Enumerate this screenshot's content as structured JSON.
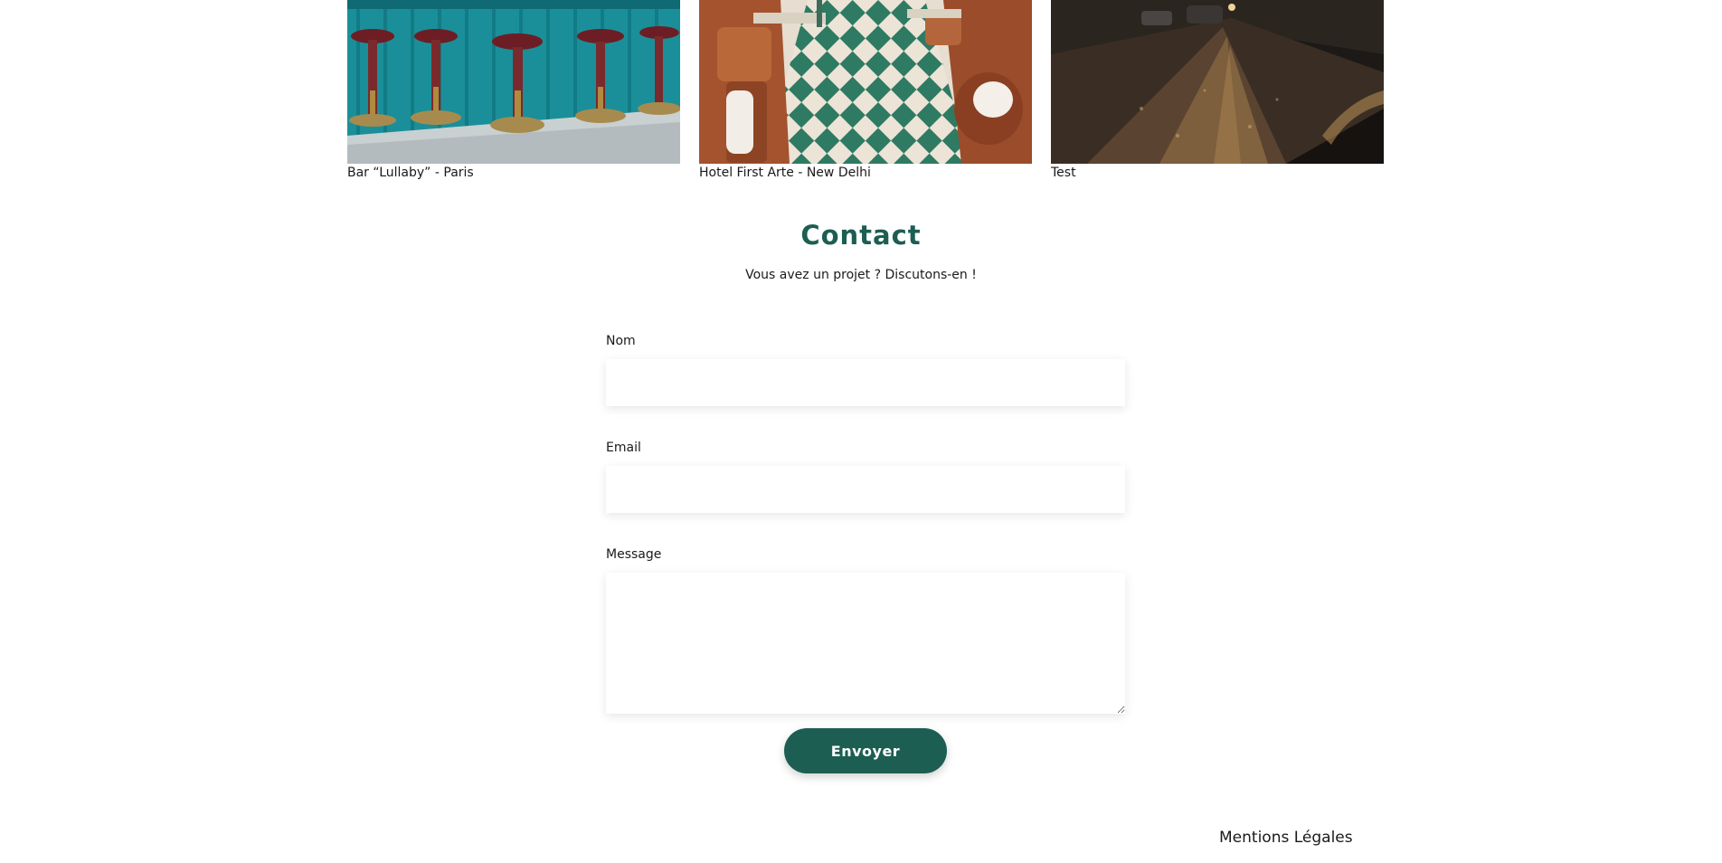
{
  "gallery": {
    "items": [
      {
        "caption": "Bar “Lullaby” - Paris"
      },
      {
        "caption": "Hotel First Arte - New Delhi"
      },
      {
        "caption": "Test"
      }
    ]
  },
  "contact": {
    "title": "Contact",
    "subtitle": "Vous avez un projet ? Discutons-en !"
  },
  "form": {
    "name_label": "Nom",
    "name_value": "",
    "email_label": "Email",
    "email_value": "",
    "message_label": "Message",
    "message_value": "",
    "submit_label": "Envoyer"
  },
  "footer": {
    "legal_label": "Mentions Légales"
  },
  "colors": {
    "accent": "#1d5e52",
    "text": "#1a1a1a",
    "background": "#ffffff"
  }
}
